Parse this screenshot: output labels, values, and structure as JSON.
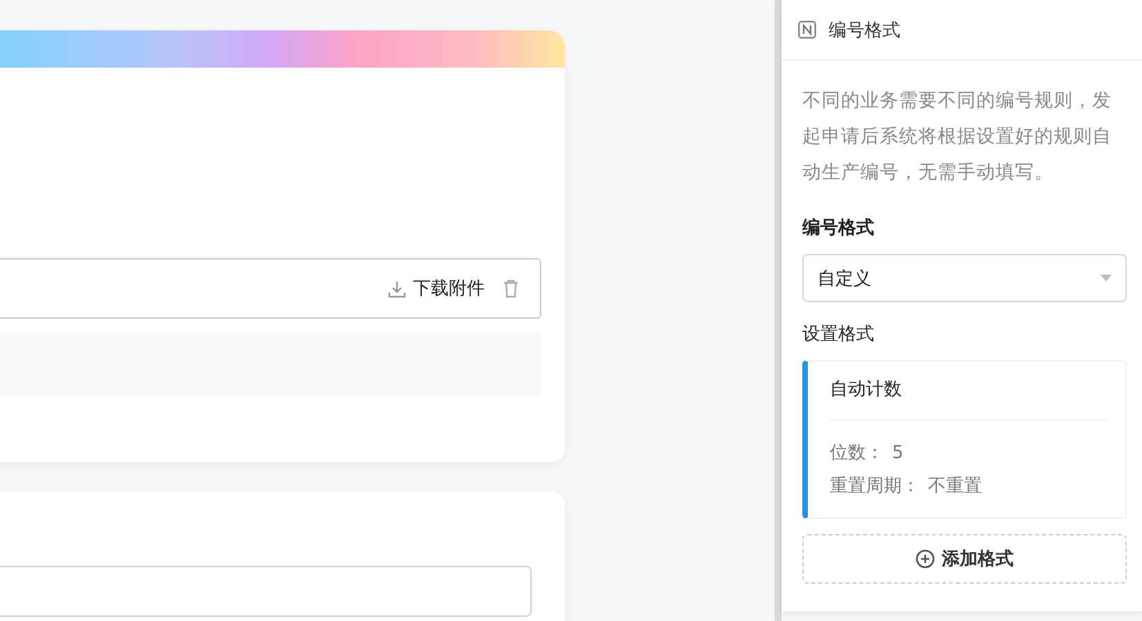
{
  "attachment": {
    "download_label": "下载附件"
  },
  "panel": {
    "title": "编号格式",
    "description": "不同的业务需要不同的编号规则，发起申请后系统将根据设置好的规则自动生产编号，无需手动填写。",
    "format_label": "编号格式",
    "format_select": {
      "value": "自定义"
    },
    "setup_label": "设置格式",
    "rules": [
      {
        "title": "自动计数",
        "fields": [
          {
            "label": "位数：",
            "value": "5"
          },
          {
            "label": "重置周期：",
            "value": "不重置"
          }
        ]
      }
    ],
    "add_button": "添加格式"
  }
}
